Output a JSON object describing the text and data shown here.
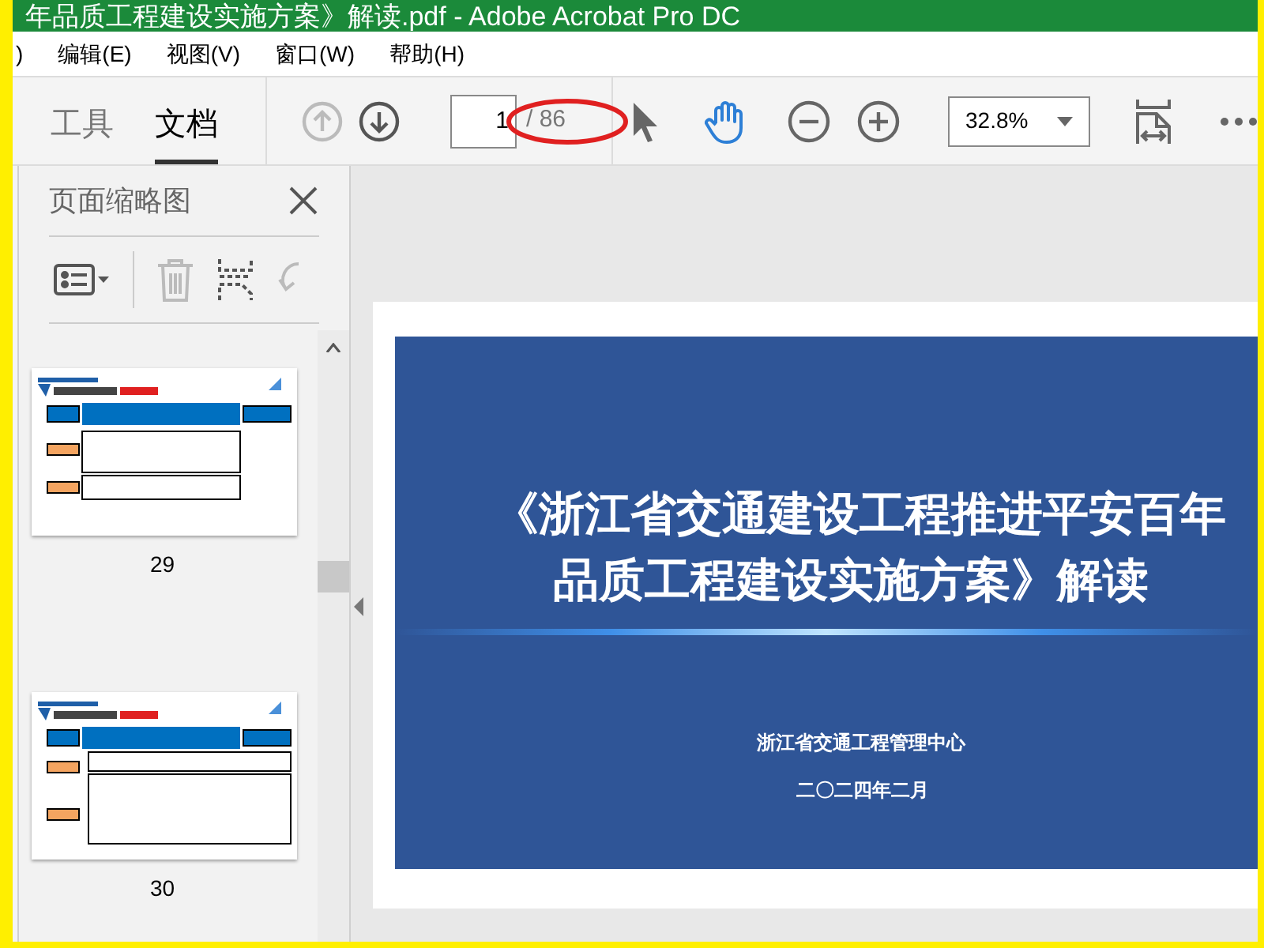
{
  "window": {
    "title": "年品质工程建设实施方案》解读.pdf - Adobe Acrobat Pro DC"
  },
  "menu": [
    ")",
    "编辑(E)",
    "视图(V)",
    "窗口(W)",
    "帮助(H)"
  ],
  "tabs": [
    {
      "label": "工具",
      "selected": false
    },
    {
      "label": "文档",
      "selected": true
    }
  ],
  "toolbar": {
    "previous_page_disabled": true,
    "page_value": "1",
    "page_total": "/ 86",
    "zoom": "32.8%",
    "hand_tool_active": true
  },
  "sidebar": {
    "title": "页面缩略图",
    "thumbnails": [
      {
        "page": "29",
        "kind": "design"
      },
      {
        "page": "30",
        "kind": "construction"
      }
    ]
  },
  "document": {
    "title_lines": [
      "《浙江省交通建设工程推进平安百年",
      "品质工程建设实施方案》解读"
    ],
    "organization": "浙江省交通工程管理中心",
    "date": "二〇二四年二月"
  }
}
